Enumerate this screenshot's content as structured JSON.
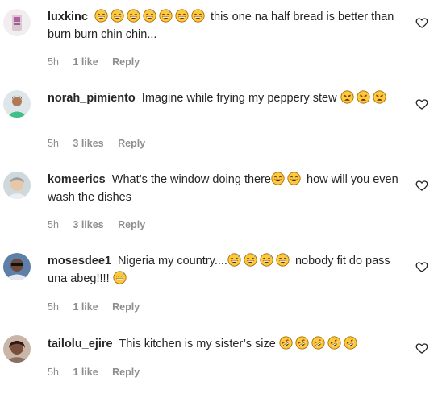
{
  "colors": {
    "text": "#262626",
    "meta": "#8e8e8e",
    "emoji_face": "#ffc83d",
    "emoji_outline": "#a46a00"
  },
  "comments": [
    {
      "username": "luxkinc",
      "text": "this one na half bread is better than burn burn chin chin...",
      "emoji_before": [
        "grinning-sweat",
        "grinning-sweat",
        "grinning-sweat",
        "grinning-sweat",
        "grinning-sweat",
        "grinning-sweat",
        "grinning-sweat"
      ],
      "emoji_after": [],
      "time": "5h",
      "likes": "1 like",
      "reply": "Reply",
      "avatar_icon": "avatar-image"
    },
    {
      "username": "norah_pimiento",
      "text": "Imagine while frying my peppery stew",
      "emoji_before": [],
      "emoji_after": [
        "weary-face",
        "weary-face",
        "weary-face"
      ],
      "time": "5h",
      "likes": "3 likes",
      "reply": "Reply",
      "avatar_icon": "avatar-image"
    },
    {
      "username": "komeerics",
      "text": "What’s the window doing there",
      "emoji_before": [],
      "emoji_after": [
        "grinning-sweat",
        "grinning-sweat"
      ],
      "text_after": "how will you even wash the dishes",
      "time": "5h",
      "likes": "3 likes",
      "reply": "Reply",
      "avatar_icon": "avatar-image"
    },
    {
      "username": "mosesdee1",
      "text": "Nigeria my country....",
      "emoji_before": [],
      "emoji_after": [
        "grinning-sweat",
        "grinning-sweat",
        "grinning-sweat",
        "grinning-sweat"
      ],
      "text_after": "nobody fit do pass una abeg!!!!",
      "emoji_end": [
        "grinning-sweat"
      ],
      "time": "5h",
      "likes": "1 like",
      "reply": "Reply",
      "avatar_icon": "avatar-image"
    },
    {
      "username": "tailolu_ejire",
      "text": "This kitchen is my sister’s size",
      "emoji_before": [],
      "emoji_after": [
        "rofl",
        "rofl",
        "rofl",
        "rofl",
        "rofl"
      ],
      "time": "5h",
      "likes": "1 like",
      "reply": "Reply",
      "avatar_icon": "avatar-image"
    }
  ]
}
